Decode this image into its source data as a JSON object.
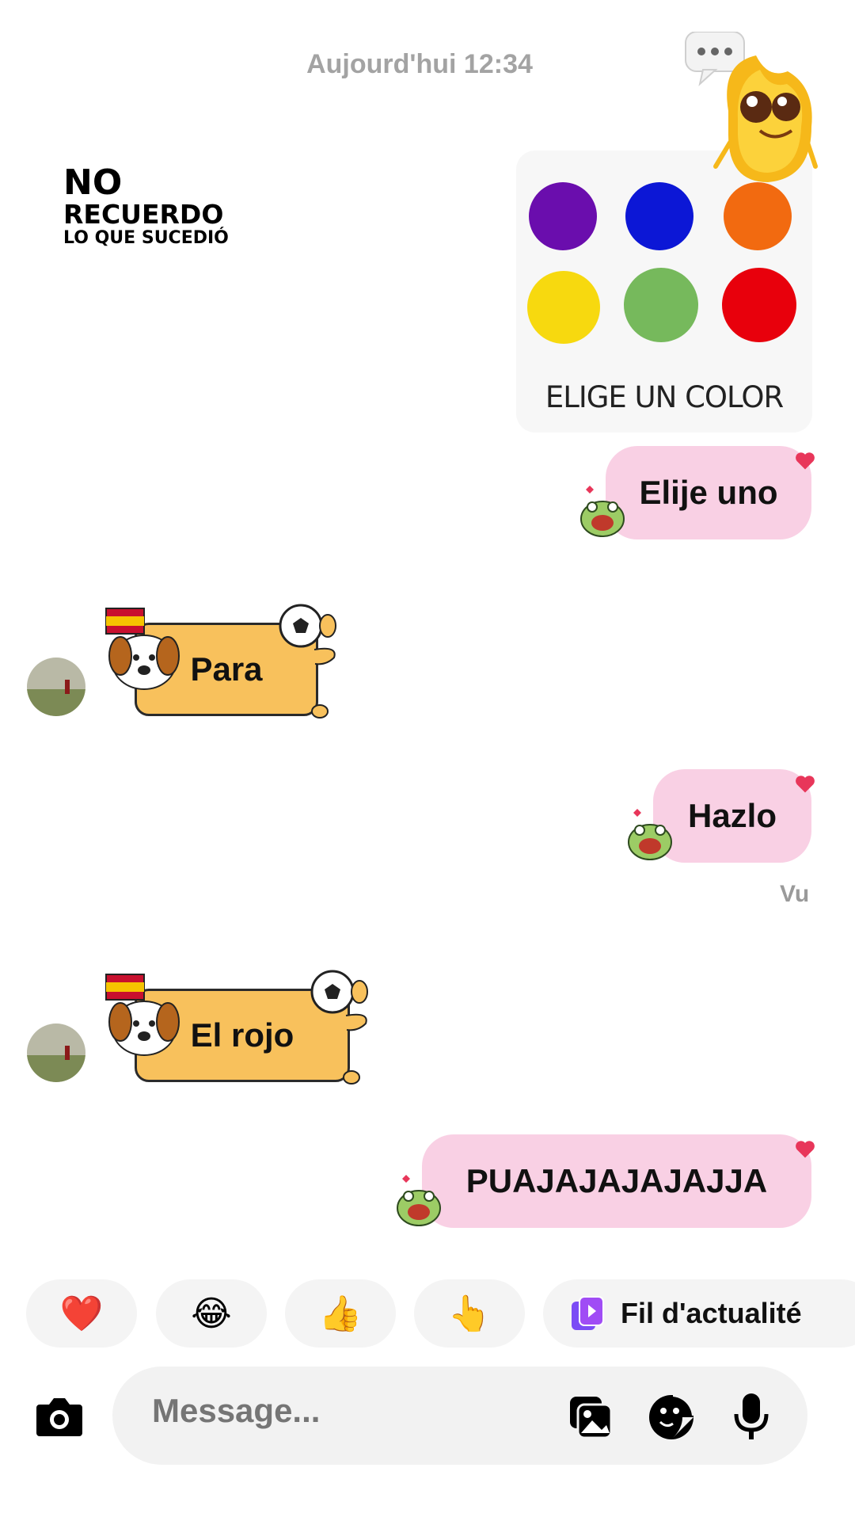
{
  "header": {
    "timestamp": "Aujourd'hui 12:34"
  },
  "overlay_text": {
    "line1": "NO",
    "line2": "RECUERDO",
    "line3": "LO QUE SUCEDIÓ"
  },
  "color_card": {
    "label": "ELIGE UN COLOR",
    "colors": [
      "#6a0dad",
      "#0c17d6",
      "#f26a10",
      "#f7d90f",
      "#76b95c",
      "#e8000c"
    ]
  },
  "messages": [
    {
      "side": "me",
      "text": "Elije uno"
    },
    {
      "side": "them",
      "text": "Para"
    },
    {
      "side": "me",
      "text": "Hazlo"
    },
    {
      "side": "them",
      "text": "El rojo"
    },
    {
      "side": "me",
      "text": "PUAJAJAJAJAJJA"
    }
  ],
  "seen_label": "Vu",
  "quick_reactions": {
    "heart": "❤️",
    "laugh": "😂",
    "thumbs_up": "👍",
    "pointing": "👆",
    "feed_label": "Fil d'actualité"
  },
  "composer": {
    "placeholder": "Message..."
  },
  "icons": [
    "camera-icon",
    "gallery-icon",
    "sticker-icon",
    "microphone-icon",
    "typing-indicator-icon"
  ],
  "colors": {
    "my_bubble": "#f9d0e4",
    "their_bubble": "#f8c15c",
    "reaction_bg": "#f4f4f4",
    "feed_icon": "#7b4cf5"
  }
}
